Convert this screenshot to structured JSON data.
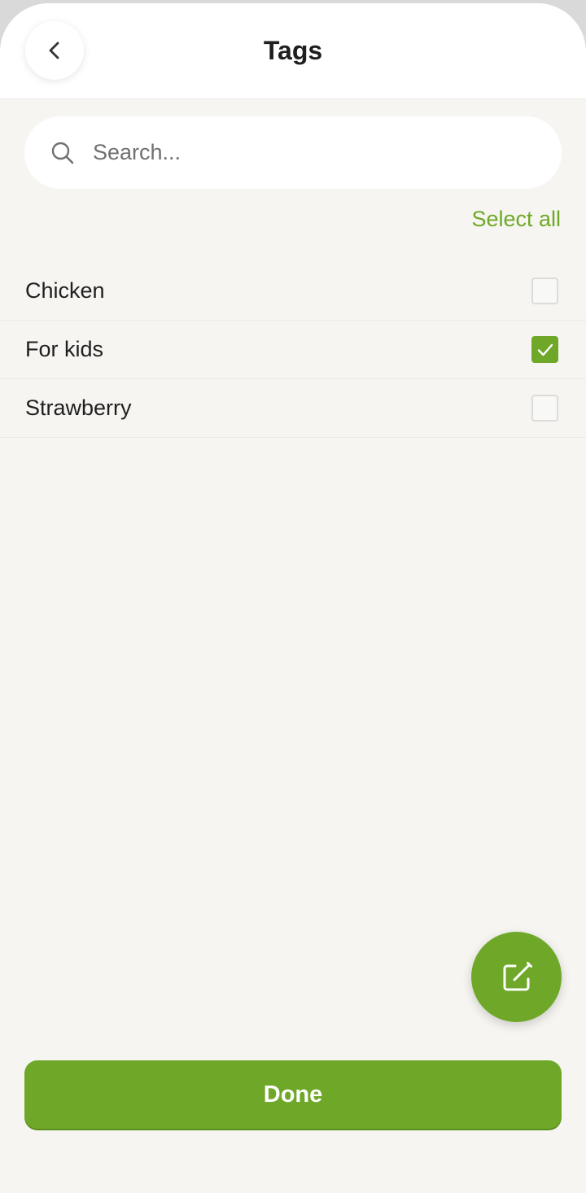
{
  "header": {
    "title": "Tags",
    "back_icon": "chevron-left-icon"
  },
  "search": {
    "placeholder": "Search...",
    "value": "",
    "icon": "search-icon"
  },
  "select_all_label": "Select all",
  "tags": [
    {
      "label": "Chicken",
      "checked": false
    },
    {
      "label": "For kids",
      "checked": true
    },
    {
      "label": "Strawberry",
      "checked": false
    }
  ],
  "fab": {
    "icon": "edit-icon"
  },
  "done_label": "Done",
  "colors": {
    "accent": "#6fa828",
    "background": "#f6f5f1",
    "header_bg": "#ffffff",
    "text": "#1f1f1f"
  }
}
